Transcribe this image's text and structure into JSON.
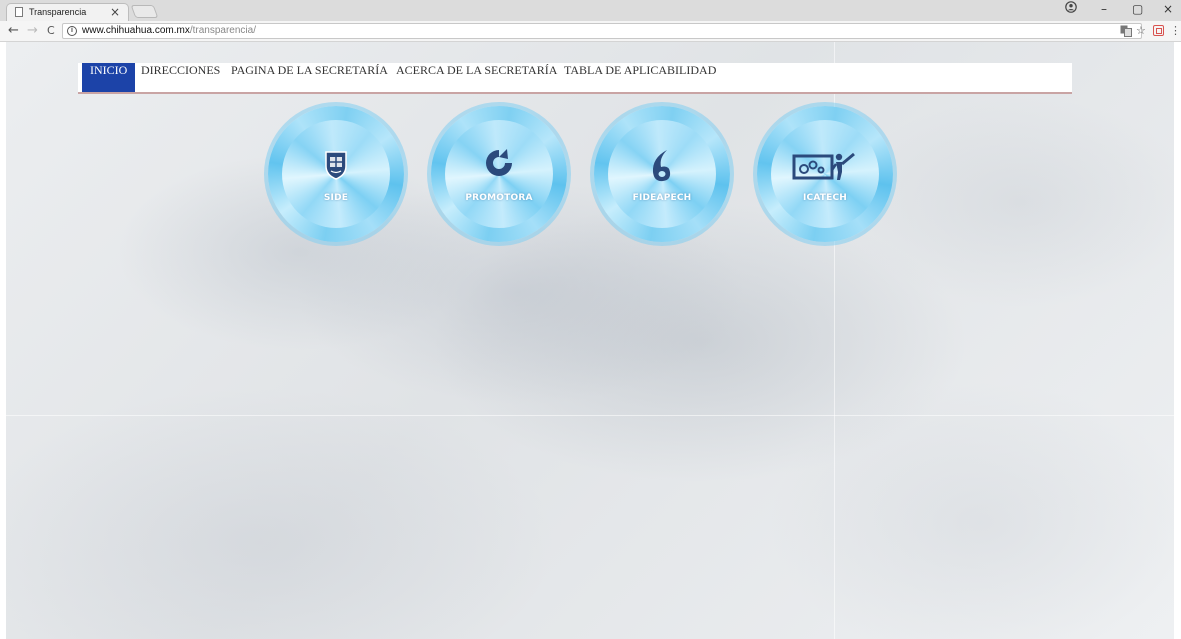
{
  "browser": {
    "tab_title": "Transparencia",
    "tab_close": "×",
    "url_host": "www.chihuahua.com.mx",
    "url_path": "/transparencia/",
    "back": "←",
    "forward": "→",
    "reload": "C",
    "minimize": "–",
    "maximize": "▢",
    "close": "×",
    "star": "☆",
    "menu": "⋮"
  },
  "menu": {
    "items": [
      {
        "label": "INICIO",
        "active": true
      },
      {
        "label": "DIRECCIONES"
      },
      {
        "label": "PAGINA DE LA SECRETARÍA"
      },
      {
        "label": "ACERCA DE LA SECRETARÍA"
      },
      {
        "label": "TABLA DE APLICABILIDAD"
      }
    ]
  },
  "badges": [
    {
      "label": "SIDE",
      "icon": "shield-icon"
    },
    {
      "label": "PROMOTORA",
      "icon": "swirl-icon"
    },
    {
      "label": "FIDEAPECH",
      "icon": "wave-icon"
    },
    {
      "label": "ICATECH",
      "icon": "teacher-board-icon"
    }
  ],
  "colors": {
    "menu_active": "#1c43a8",
    "badge_blue": "#7fd0f2",
    "logo_dark": "#2b4a7c"
  }
}
